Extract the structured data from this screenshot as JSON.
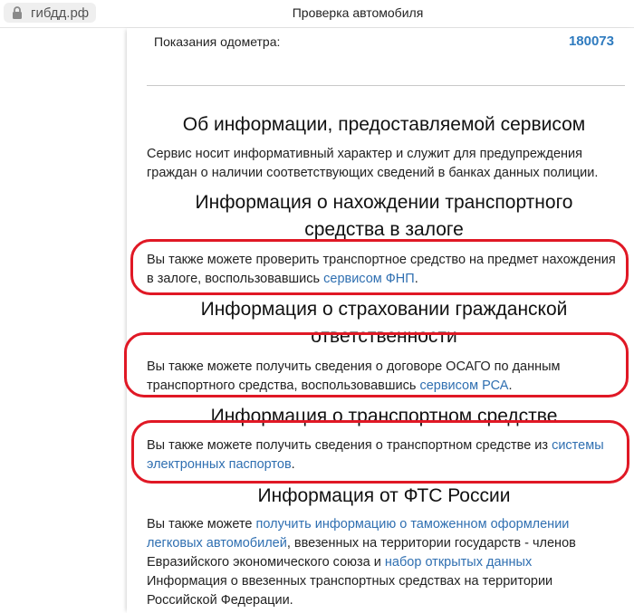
{
  "browser": {
    "url": "гибдд.рф",
    "title": "Проверка автомобиля"
  },
  "odometer": {
    "label": "Показания одометра:",
    "value": "180073"
  },
  "sections": {
    "about": {
      "title": "Об информации, предоставляемой сервисом",
      "text": "Сервис носит информативный характер и служит для предупреждения граждан о наличии соответствующих сведений в банках данных полиции."
    },
    "pledge": {
      "title_line1": "Информация о нахождении транспортного",
      "title_line2": "средства в залоге",
      "text": "Вы также можете проверить транспортное средство на предмет нахождения в залоге, воспользовавшись ",
      "link": "сервисом ФНП",
      "tail": "."
    },
    "insurance": {
      "title_line1": "Информация о страховании гражданской",
      "title_line2": "ответственности",
      "text": "Вы также можете получить сведения о договоре ОСАГО по данным транспортного средства, воспользовавшись ",
      "link": "сервисом РСА",
      "tail": "."
    },
    "vehicle": {
      "title": "Информация о транспортном средстве",
      "text": "Вы также можете получить сведения о транспортном средстве из ",
      "link": "системы электронных паспортов",
      "tail": "."
    },
    "customs": {
      "title": "Информация от ФТС России",
      "text1": "Вы также можете ",
      "link1": "получить информацию о таможенном оформлении легковых автомобилей",
      "text2": ", ввезенных на территории государств - членов Евразийского экономического союза и ",
      "link2": "набор открытых данных",
      "text3": " Информация о ввезенных транспортных средствах на территории Российской Федерации."
    }
  },
  "colors": {
    "link": "#2f6fb1",
    "odometer_value": "#2f7bbf",
    "highlight_box": "#e01825"
  }
}
